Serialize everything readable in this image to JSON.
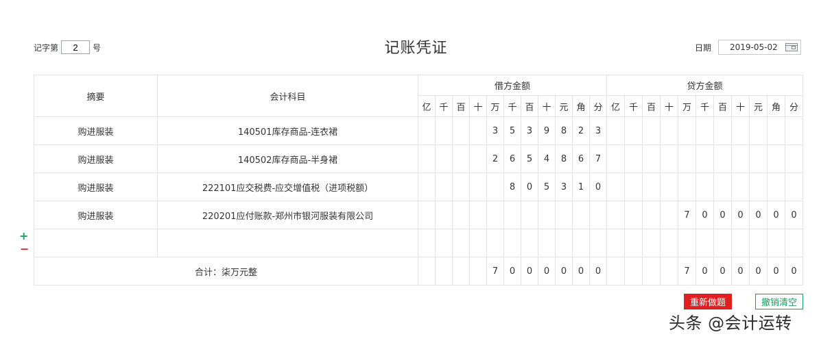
{
  "header": {
    "voucher_prefix": "记字第",
    "voucher_number": "2",
    "voucher_suffix": "号",
    "title": "记账凭证",
    "date_label": "日期",
    "date_value": "2019-05-02"
  },
  "table": {
    "col_summary": "摘要",
    "col_account": "会计科目",
    "debit_label": "借方金额",
    "credit_label": "贷方金额",
    "digit_headers": [
      "亿",
      "千",
      "百",
      "十",
      "万",
      "千",
      "百",
      "十",
      "元",
      "角",
      "分"
    ],
    "rows": [
      {
        "summary": "购进服装",
        "account": "140501库存商品-连衣裙",
        "debit": [
          "",
          "",
          "",
          "",
          "3",
          "5",
          "3",
          "9",
          "8",
          "2",
          "3"
        ],
        "credit": [
          "",
          "",
          "",
          "",
          "",
          "",
          "",
          "",
          "",
          "",
          ""
        ]
      },
      {
        "summary": "购进服装",
        "account": "140502库存商品-半身裙",
        "debit": [
          "",
          "",
          "",
          "",
          "2",
          "6",
          "5",
          "4",
          "8",
          "6",
          "7"
        ],
        "credit": [
          "",
          "",
          "",
          "",
          "",
          "",
          "",
          "",
          "",
          "",
          ""
        ]
      },
      {
        "summary": "购进服装",
        "account": "222101应交税费-应交增值税（进项税额）",
        "debit": [
          "",
          "",
          "",
          "",
          "",
          "8",
          "0",
          "5",
          "3",
          "1",
          "0"
        ],
        "credit": [
          "",
          "",
          "",
          "",
          "",
          "",
          "",
          "",
          "",
          "",
          ""
        ]
      },
      {
        "summary": "购进服装",
        "account": "220201应付账款-郑州市银河服装有限公司",
        "debit": [
          "",
          "",
          "",
          "",
          "",
          "",
          "",
          "",
          "",
          "",
          ""
        ],
        "credit": [
          "",
          "",
          "",
          "",
          "7",
          "0",
          "0",
          "0",
          "0",
          "0",
          "0"
        ]
      },
      {
        "summary": "",
        "account": "",
        "debit": [
          "",
          "",
          "",
          "",
          "",
          "",
          "",
          "",
          "",
          "",
          ""
        ],
        "credit": [
          "",
          "",
          "",
          "",
          "",
          "",
          "",
          "",
          "",
          "",
          ""
        ]
      }
    ],
    "total_label": "合计：柒万元整",
    "total_debit": [
      "",
      "",
      "",
      "",
      "7",
      "0",
      "0",
      "0",
      "0",
      "0",
      "0"
    ],
    "total_credit": [
      "",
      "",
      "",
      "",
      "7",
      "0",
      "0",
      "0",
      "0",
      "0",
      "0"
    ]
  },
  "controls": {
    "add_row": "+",
    "remove_row": "−"
  },
  "buttons": {
    "redo": "重新做题",
    "clear": "撤销清空"
  },
  "watermark": "头条 @会计运转",
  "colors": {
    "redo_bg": "#e02020",
    "clear_border": "#1a9a5c",
    "plus": "#1aa260",
    "minus": "#d9262b"
  }
}
